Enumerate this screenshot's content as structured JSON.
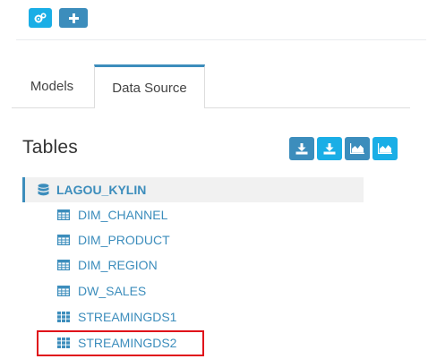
{
  "toolbar": {
    "buttons": [
      {
        "icon": "gears-icon"
      },
      {
        "icon": "plus-icon"
      }
    ]
  },
  "tabs": [
    {
      "label": "Models",
      "active": false
    },
    {
      "label": "Data Source",
      "active": true
    }
  ],
  "tables_panel": {
    "title": "Tables",
    "tool_buttons": [
      {
        "icon": "download-icon"
      },
      {
        "icon": "download-icon"
      },
      {
        "icon": "area-chart-icon"
      },
      {
        "icon": "area-chart-icon"
      }
    ]
  },
  "tree": {
    "database": {
      "label": "LAGOU_KYLIN",
      "icon": "database-icon"
    },
    "tables": [
      {
        "label": "DIM_CHANNEL",
        "icon": "table-icon"
      },
      {
        "label": "DIM_PRODUCT",
        "icon": "table-icon"
      },
      {
        "label": "DIM_REGION",
        "icon": "table-icon"
      },
      {
        "label": "DW_SALES",
        "icon": "table-icon"
      },
      {
        "label": "STREAMINGDS1",
        "icon": "streaming-table-icon"
      },
      {
        "label": "STREAMINGDS2",
        "icon": "streaming-table-icon",
        "highlighted": true
      }
    ]
  },
  "colors": {
    "primary": "#3c8dbc",
    "info": "#1aaee6",
    "highlight": "#e0101a"
  }
}
